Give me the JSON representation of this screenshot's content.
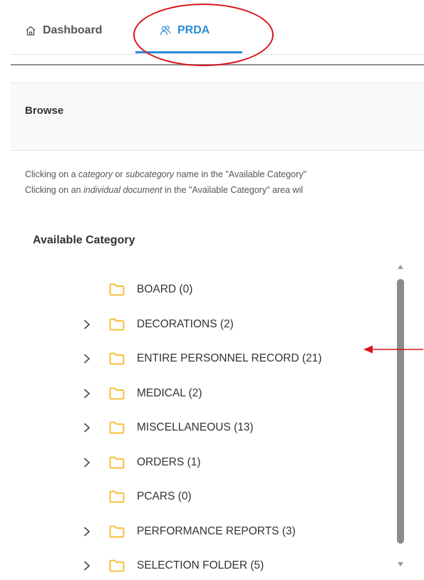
{
  "tabs": {
    "dashboard_label": "Dashboard",
    "prda_label": "PRDA",
    "active": "PRDA",
    "accent": "#2a8cd6"
  },
  "browse": {
    "title": "Browse",
    "instructions": {
      "line1": {
        "a": "Clicking on a ",
        "b": "category",
        "c": " or ",
        "d": "subcategory",
        "e": " name in the \"Available Category\""
      },
      "line2": {
        "a": "Clicking on an ",
        "b": "individual document",
        "c": " in the \"Available Category\" area wil"
      }
    }
  },
  "available_category": {
    "title": "Available Category",
    "items": [
      {
        "label": "BOARD (0)",
        "expandable": false
      },
      {
        "label": "DECORATIONS (2)",
        "expandable": true
      },
      {
        "label": "ENTIRE PERSONNEL RECORD (21)",
        "expandable": true
      },
      {
        "label": "MEDICAL (2)",
        "expandable": true
      },
      {
        "label": "MISCELLANEOUS (13)",
        "expandable": true
      },
      {
        "label": "ORDERS (1)",
        "expandable": true
      },
      {
        "label": "PCARS (0)",
        "expandable": false
      },
      {
        "label": "PERFORMANCE REPORTS (3)",
        "expandable": true
      },
      {
        "label": "SELECTION FOLDER (5)",
        "expandable": true
      }
    ]
  },
  "colors": {
    "folder": "#f5b820",
    "annotation": "#d9131b"
  },
  "icons": {
    "dashboard": "home-icon",
    "prda": "users-icon",
    "folder": "folder-icon",
    "expand": "chevron-right-icon"
  }
}
